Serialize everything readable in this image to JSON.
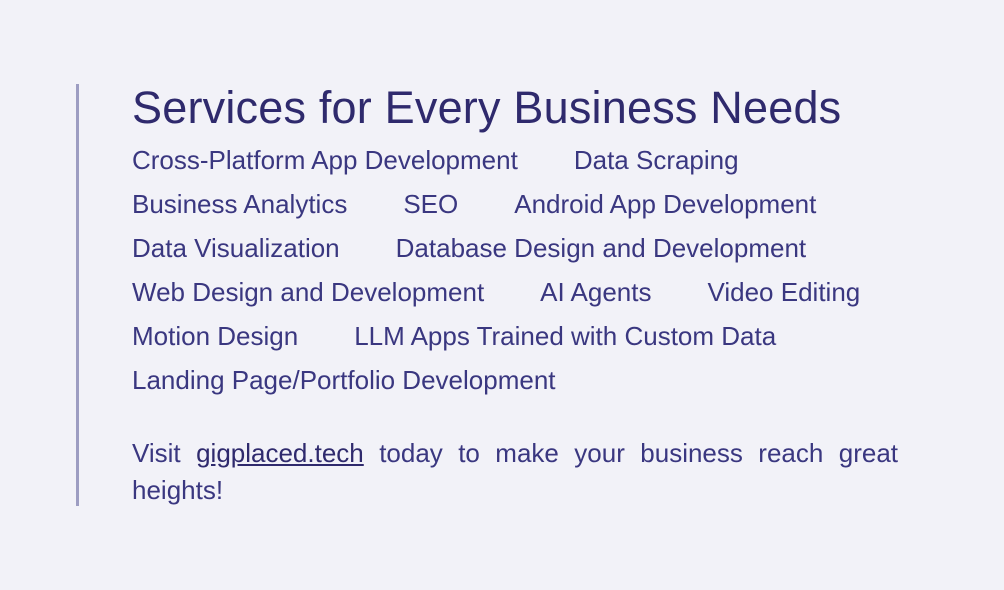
{
  "title": "Services for Every Business Needs",
  "services": {
    "row1": [
      "Cross-Platform App Development",
      "Data Scraping"
    ],
    "row2": [
      "Business Analytics",
      "SEO",
      "Android App Development"
    ],
    "row3": [
      "Data Visualization",
      "Database Design and Development"
    ],
    "row4": [
      "Web Design and Development",
      "AI Agents",
      "Video Editing"
    ],
    "row5": [
      "Motion Design",
      "LLM Apps Trained with Custom Data"
    ],
    "row6": [
      "Landing Page/Portfolio Development"
    ]
  },
  "footer": {
    "prefix": "Visit",
    "link": "gigplaced.tech",
    "suffix": "today to make your business reach great heights!"
  },
  "colors": {
    "background": "#f2f2f8",
    "text": "#2f2a6d",
    "accent_border": "#9d9dc2"
  }
}
